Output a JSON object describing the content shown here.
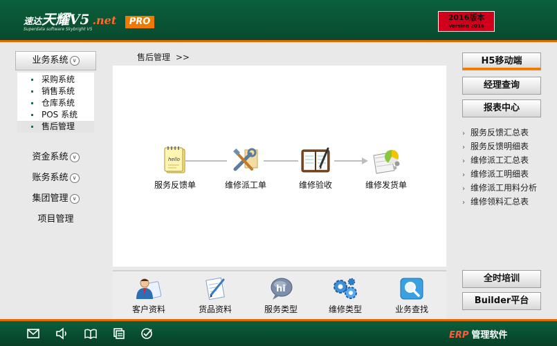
{
  "header": {
    "logo_brand": "速达",
    "logo_name": "天耀",
    "logo_version": "V5",
    "logo_net": ".net",
    "logo_subtitle": "Superdata software Skybright V5",
    "badge": "PRO",
    "version_title": "2016版本",
    "version_sub": "Version 2016"
  },
  "sidebar": {
    "sections": [
      {
        "label": "业务系统"
      },
      {
        "label": "资金系统"
      },
      {
        "label": "账务系统"
      },
      {
        "label": "集团管理"
      },
      {
        "label": "项目管理"
      }
    ],
    "submenu": [
      {
        "label": "采购系统"
      },
      {
        "label": "销售系统"
      },
      {
        "label": "仓库系统"
      },
      {
        "label": "POS 系统"
      },
      {
        "label": "售后管理"
      }
    ]
  },
  "main": {
    "breadcrumb": "售后管理",
    "breadcrumb_arrow": ">>",
    "workflow": [
      {
        "label": "服务反馈单",
        "icon": "notepad-hello-icon"
      },
      {
        "label": "维修派工单",
        "icon": "tools-icon"
      },
      {
        "label": "维修验收",
        "icon": "notebook-pen-icon"
      },
      {
        "label": "维修发货单",
        "icon": "delivery-pie-chart-icon"
      }
    ],
    "quick": [
      {
        "label": "客户资料",
        "icon": "customer-icon"
      },
      {
        "label": "货品资料",
        "icon": "goods-document-icon"
      },
      {
        "label": "服务类型",
        "icon": "hi-bubble-icon"
      },
      {
        "label": "维修类型",
        "icon": "gears-icon"
      },
      {
        "label": "业务查找",
        "icon": "magnifier-icon"
      }
    ]
  },
  "right": {
    "buttons": [
      {
        "label": "H5移动端"
      },
      {
        "label": "经理查询"
      },
      {
        "label": "报表中心"
      }
    ],
    "reports": [
      {
        "label": "服务反馈汇总表"
      },
      {
        "label": "服务反馈明细表"
      },
      {
        "label": "维修派工汇总表"
      },
      {
        "label": "维修派工明细表"
      },
      {
        "label": "维修派工用料分析"
      },
      {
        "label": "维修领料汇总表"
      }
    ],
    "bottom_buttons": [
      {
        "label": "全时培训"
      },
      {
        "label": "Builder平台"
      }
    ]
  },
  "footer": {
    "erp": "ERP",
    "brand": "管理软件",
    "icons": [
      "mail-icon",
      "speaker-icon",
      "book-icon",
      "window-copy-icon",
      "check-circle-icon"
    ]
  },
  "colors": {
    "brand_green": "#0b5f3b",
    "accent_orange": "#e46a00",
    "version_red": "#d1001b"
  }
}
